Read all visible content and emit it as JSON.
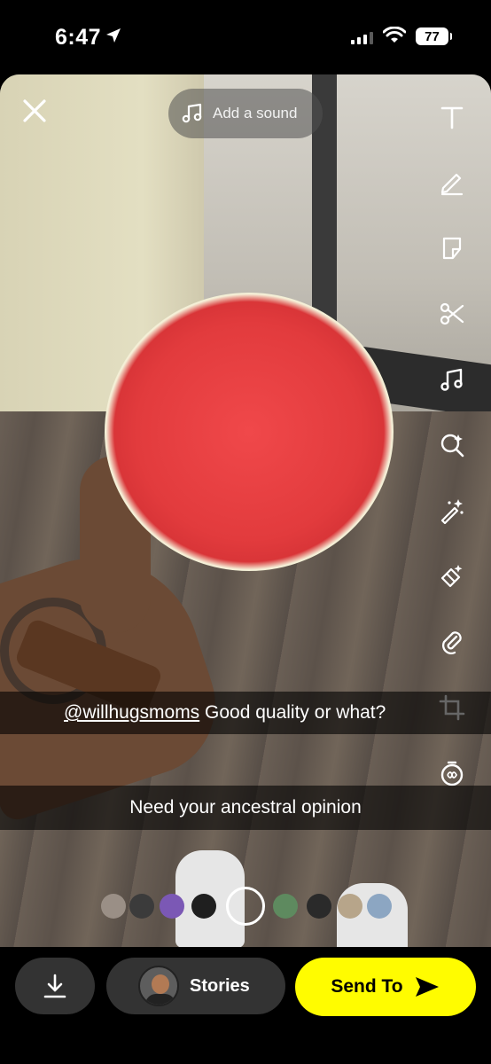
{
  "status_bar": {
    "time": "6:47",
    "battery": "77"
  },
  "editor": {
    "add_sound_label": "Add a sound",
    "tools": [
      "text-tool",
      "draw-tool",
      "sticker-tool",
      "scissors-tool",
      "music-tool",
      "lens-search-tool",
      "magic-wand-tool",
      "eraser-tool",
      "paperclip-tool",
      "crop-tool",
      "timer-tool"
    ]
  },
  "captions": {
    "mention": "@willhugsmoms",
    "line1_text": " Good quality or what?",
    "line2_text": "Need your ancestral opinion"
  },
  "lens_carousel": {
    "colors": [
      "#9a8f86",
      "#3b3b3b",
      "#7b58b5",
      "#1f1f1f",
      "#5e8a5f",
      "#2a2a2a",
      "#b7a58a",
      "#8ca6c2"
    ]
  },
  "bottom_bar": {
    "stories_label": "Stories",
    "send_label": "Send To"
  },
  "colors": {
    "send_button": "#fffc00",
    "pill_bg": "#333333"
  }
}
